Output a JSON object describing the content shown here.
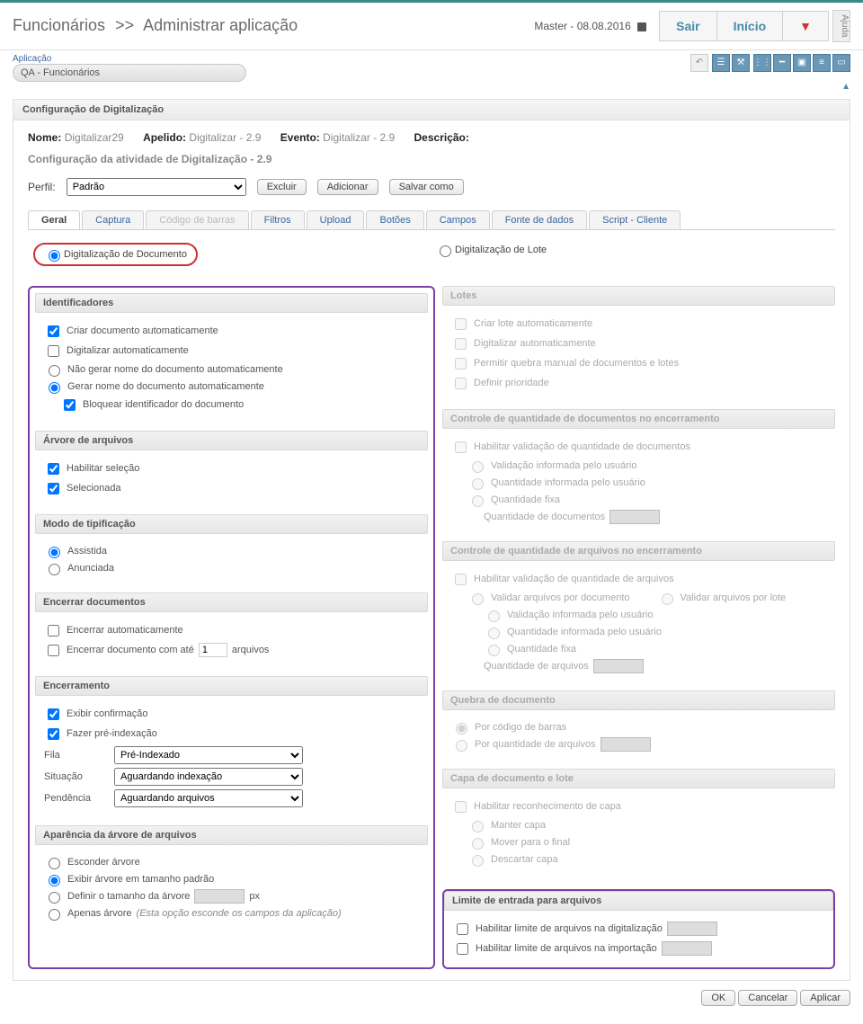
{
  "header": {
    "breadcrumb_a": "Funcionários",
    "sep": ">>",
    "breadcrumb_b": "Administrar aplicação",
    "user": "Master - 08.08.2016",
    "nav": {
      "sair": "Sair",
      "inicio": "Início",
      "arrow": "▼"
    },
    "help": "Ajuda"
  },
  "app": {
    "label": "Aplicação",
    "value": "QA - Funcionários"
  },
  "panel": {
    "title": "Configuração de Digitalização",
    "info": {
      "nome_lbl": "Nome:",
      "nome": "Digitalizar29",
      "apelido_lbl": "Apelido:",
      "apelido": "Digitalizar - 2.9",
      "evento_lbl": "Evento:",
      "evento": "Digitalizar - 2.9",
      "desc_lbl": "Descrição:"
    },
    "subtitle": "Configuração da atividade de Digitalização - 2.9",
    "perfil_lbl": "Perfil:",
    "perfil_val": "Padrão",
    "btns": {
      "excluir": "Excluir",
      "adicionar": "Adicionar",
      "salvar": "Salvar como"
    }
  },
  "tabs": [
    "Geral",
    "Captura",
    "Código de barras",
    "Filtros",
    "Upload",
    "Botões",
    "Campos",
    "Fonte de dados",
    "Script - Cliente"
  ],
  "modes": {
    "doc": "Digitalização de Documento",
    "lote": "Digitalização de Lote"
  },
  "left": {
    "identificadores": {
      "hdr": "Identificadores",
      "criar": "Criar documento automaticamente",
      "digit": "Digitalizar automaticamente",
      "nao_gerar": "Não gerar nome do documento automaticamente",
      "gerar": "Gerar nome do documento automaticamente",
      "bloquear": "Bloquear identificador do documento"
    },
    "arvore": {
      "hdr": "Árvore de arquivos",
      "hab": "Habilitar seleção",
      "sel": "Selecionada"
    },
    "modo": {
      "hdr": "Modo de tipificação",
      "ass": "Assistida",
      "anu": "Anunciada"
    },
    "encerrar_doc": {
      "hdr": "Encerrar documentos",
      "auto": "Encerrar automaticamente",
      "ate_a": "Encerrar documento com até",
      "ate_val": "1",
      "ate_b": "arquivos"
    },
    "encerramento": {
      "hdr": "Encerramento",
      "conf": "Exibir confirmação",
      "pre": "Fazer pré-indexação",
      "fila_lbl": "Fila",
      "fila": "Pré-Indexado",
      "sit_lbl": "Situação",
      "sit": "Aguardando indexação",
      "pend_lbl": "Pendência",
      "pend": "Aguardando arquivos"
    },
    "aparencia": {
      "hdr": "Aparência da árvore de arquivos",
      "esc": "Esconder árvore",
      "tam_pad": "Exibir árvore em tamanho padrão",
      "def_a": "Definir o tamanho da árvore",
      "px": "px",
      "apenas": "Apenas árvore",
      "apenas_note": "(Esta opção esconde os campos da aplicação)"
    }
  },
  "right": {
    "lotes": {
      "hdr": "Lotes",
      "criar": "Criar lote automaticamente",
      "digit": "Digitalizar automaticamente",
      "permitir": "Permitir quebra manual de documentos e lotes",
      "prio": "Definir prioridade"
    },
    "ctrl_doc": {
      "hdr": "Controle de quantidade de documentos no encerramento",
      "hab": "Habilitar validação de quantidade de documentos",
      "val_user": "Validação informada pelo usuário",
      "qtd_user": "Quantidade informada pelo usuário",
      "fixa": "Quantidade fixa",
      "qtd_lbl": "Quantidade de documentos"
    },
    "ctrl_arq": {
      "hdr": "Controle de quantidade de arquivos no encerramento",
      "hab": "Habilitar validação de quantidade de arquivos",
      "por_doc": "Validar arquivos por documento",
      "por_lote": "Validar arquivos por lote",
      "val_user": "Validação informada pelo usuário",
      "qtd_user": "Quantidade informada pelo usuário",
      "fixa": "Quantidade fixa",
      "qtd_lbl": "Quantidade de arquivos"
    },
    "quebra": {
      "hdr": "Quebra de documento",
      "bar": "Por código de barras",
      "qtd": "Por quantidade de arquivos"
    },
    "capa": {
      "hdr": "Capa de documento e lote",
      "hab": "Habilitar reconhecimento de capa",
      "manter": "Manter capa",
      "mover": "Mover para o final",
      "desc": "Descartar capa"
    },
    "limite": {
      "hdr": "Limite de entrada para arquivos",
      "digit": "Habilitar limite de arquivos na digitalização",
      "imp": "Habilitar limite de arquivos na importação"
    }
  },
  "footer": {
    "ok": "OK",
    "cancelar": "Cancelar",
    "aplicar": "Aplicar"
  }
}
